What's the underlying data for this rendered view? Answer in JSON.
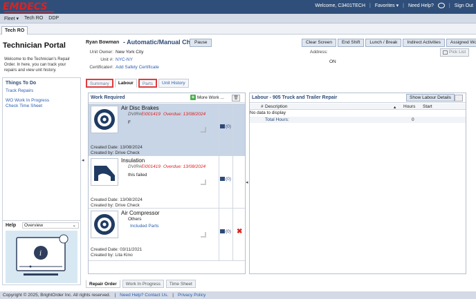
{
  "app": {
    "logo": "EMDECS"
  },
  "topbar": {
    "welcome": "Welcome, C3401TECH",
    "favorites": "Favorites ▾",
    "need_help": "Need Help?",
    "sign_out": "Sign Out"
  },
  "menu": {
    "items": [
      "Fleet ▾",
      "Tech RO",
      "DDP"
    ]
  },
  "tab": {
    "label": "Tech RO"
  },
  "left": {
    "title": "Technician Portal",
    "welcome": "Welcome to the Technician's Repair Order. In here, you can track your repairs and view unit history.",
    "todo_title": "Things To Do",
    "todo_links": [
      "Track Repairs",
      "WO Work In Progress",
      "Check Time Sheet"
    ],
    "help_label": "Help",
    "help_select": "Overview"
  },
  "header": {
    "tech_name": "Ryan Bowman",
    "job_title": "- Automatic/Manual Cha...",
    "pause": "Pause",
    "buttons": [
      "Clear Screen",
      "End Shift",
      "Lunch / Break",
      "Indirect Activities",
      "Assigned Work"
    ],
    "unit_owner_label": "Unit Owner:",
    "unit_owner": "New York City",
    "unit_label": "Unit #:",
    "unit": "NYC-NY",
    "cert_label": "Certificate#:",
    "cert_link": "Add Safety Certificate",
    "address_label": "Address:",
    "on_label": "ON",
    "pick_list": "Pick List"
  },
  "subtabs": [
    "Summary",
    "Labour",
    "Parts",
    "Unit History"
  ],
  "work": {
    "title": "Work Required",
    "more_work": "More Work ...",
    "rows": [
      {
        "name": "Air Disc Brakes",
        "dvir_prefix": "DVIR#",
        "dvir_code": "EI001419",
        "overdue": "Overdue: 13/08/2024",
        "desc": "F",
        "created_date": "Created Date:  13/08/2024",
        "created_by": "Created by:  Drive Check",
        "parts": "(0)"
      },
      {
        "name": "Insulation",
        "dvir_prefix": "DVIR#",
        "dvir_code": "EI001419",
        "overdue": "Overdue: 13/08/2024",
        "desc": "this failed",
        "created_date": "Created Date:  13/08/2024",
        "created_by": "Created by:  Drive Check",
        "parts": "(0)"
      },
      {
        "name": "Air Compressor",
        "desc": "Others",
        "link": "Included Parts",
        "created_date": "Created Date:  03/11/2021",
        "created_by": "Created by:  Lita Kino",
        "parts": "(0)"
      }
    ]
  },
  "labour": {
    "title": "Labour - 905 Truck and Trailer Repair",
    "show_btn": "Show Labour Details",
    "cols": [
      "#",
      "Description",
      "Hours",
      "Start"
    ],
    "no_data": "No data to display",
    "total_label": "Total Hours:",
    "total_value": "0"
  },
  "bottom_tabs": [
    "Repair Order",
    "Work In Progress",
    "Time Sheet"
  ],
  "footer": {
    "copyright": "Copyright © 2025, BrightOrder Inc. All rights reserved.",
    "help": "Need Help? Contact Us.",
    "privacy": "Privacy Policy"
  }
}
